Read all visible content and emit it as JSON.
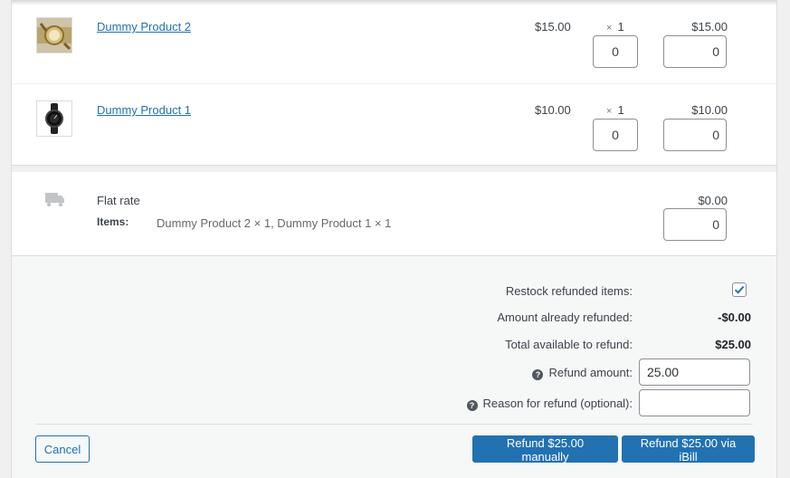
{
  "items": [
    {
      "name": "Dummy Product 2",
      "cost": "$15.00",
      "qty_prefix": "×",
      "qty": "1",
      "line_total": "$15.00",
      "refund_qty": "0",
      "refund_total": "0",
      "thumb": "gold-watch-thumbnail"
    },
    {
      "name": "Dummy Product 1",
      "cost": "$10.00",
      "qty_prefix": "×",
      "qty": "1",
      "line_total": "$10.00",
      "refund_qty": "0",
      "refund_total": "0",
      "thumb": "black-watch-thumbnail"
    }
  ],
  "shipping": {
    "icon": "truck-icon",
    "name": "Flat rate",
    "items_label": "Items:",
    "items_value": "Dummy Product 2 × 1, Dummy Product 1 × 1",
    "total": "$0.00",
    "refund_total": "0"
  },
  "refund": {
    "restock_label": "Restock refunded items:",
    "restock_checked": true,
    "already_refunded_label": "Amount already refunded:",
    "already_refunded_value": "-$0.00",
    "available_label": "Total available to refund:",
    "available_value": "$25.00",
    "amount_label": "Refund amount:",
    "amount_value": "25.00",
    "reason_label": "Reason for refund (optional):",
    "reason_value": "",
    "help_glyph": "?"
  },
  "actions": {
    "cancel_label": "Cancel",
    "manual_label": "Refund $25.00 manually",
    "gateway_label": "Refund $25.00 via iBill"
  },
  "colors": {
    "accent": "#2271b1",
    "checkmark": "#2271b1"
  }
}
